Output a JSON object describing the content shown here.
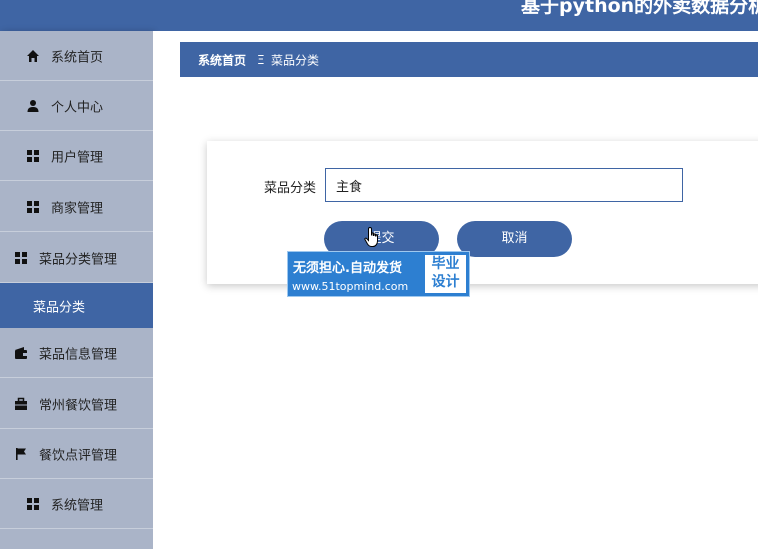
{
  "header": {
    "title": "基于python的外卖数据分析"
  },
  "sidebar": {
    "items": [
      {
        "label": "系统首页",
        "icon": "home-icon"
      },
      {
        "label": "个人中心",
        "icon": "user-icon"
      },
      {
        "label": "用户管理",
        "icon": "grid-icon"
      },
      {
        "label": "商家管理",
        "icon": "grid-icon"
      },
      {
        "label": "菜品分类管理",
        "icon": "grid-icon"
      },
      {
        "label": "菜品分类",
        "icon": "",
        "active": true
      },
      {
        "label": "菜品信息管理",
        "icon": "wallet-icon"
      },
      {
        "label": "常州餐饮管理",
        "icon": "briefcase-icon"
      },
      {
        "label": "餐饮点评管理",
        "icon": "flag-icon"
      },
      {
        "label": "系统管理",
        "icon": "grid-icon"
      }
    ]
  },
  "breadcrumb": {
    "home": "系统首页",
    "separator": "Ξ",
    "current": "菜品分类"
  },
  "form": {
    "field_label": "菜品分类",
    "field_value": "主食",
    "submit_label": "提交",
    "cancel_label": "取消"
  },
  "watermark": {
    "line1": "无须担心.自动发货",
    "line2": "www.51topmind.com",
    "badge_line1": "毕业",
    "badge_line2": "设计"
  },
  "colors": {
    "primary": "#3f65a4",
    "sidebar_bg": "#aab4c8",
    "watermark_bg": "#2d7fd1"
  }
}
